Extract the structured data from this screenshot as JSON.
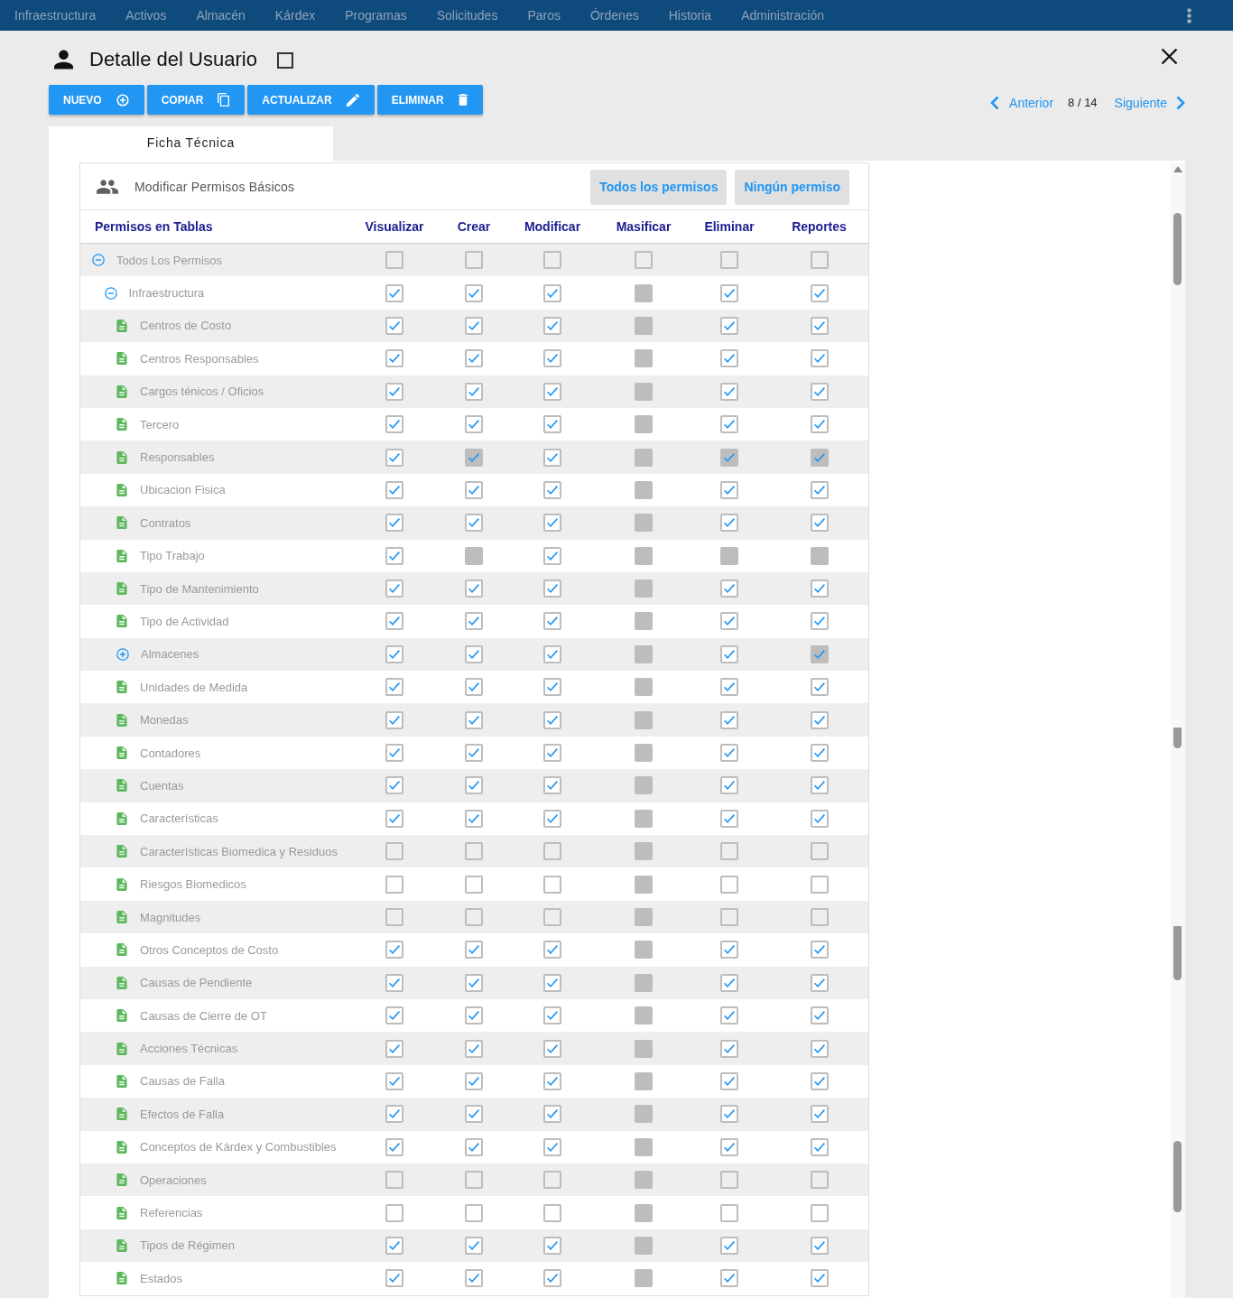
{
  "nav": {
    "items": [
      "Infraestructura",
      "Activos",
      "Almacén",
      "Kárdex",
      "Programas",
      "Solicitudes",
      "Paros",
      "Órdenes",
      "Historia",
      "Administración"
    ]
  },
  "header": {
    "title": "Detalle del Usuario",
    "checked": false
  },
  "toolbar": {
    "buttons": [
      {
        "label": "NUEVO",
        "kind": "new"
      },
      {
        "label": "COPIAR",
        "kind": "copy"
      },
      {
        "label": "ACTUALIZAR",
        "kind": "update"
      },
      {
        "label": "ELIMINAR",
        "kind": "delete"
      }
    ]
  },
  "pager": {
    "previous": "Anterior",
    "position": "8 / 14",
    "next": "Siguiente"
  },
  "tabs": [
    {
      "label": "Ficha Técnica",
      "selected": true
    }
  ],
  "permissions": {
    "title": "Modificar Permisos Básicos",
    "actions": [
      "Todos los permisos",
      "Ningún permiso"
    ],
    "columns": [
      "Permisos en Tablas",
      "Visualizar",
      "Crear",
      "Modificar",
      "Masificar",
      "Eliminar",
      "Reportes"
    ],
    "tree": [
      {
        "label": "Todos Los Permisos",
        "kind": "group",
        "expanded": true,
        "cells": [
          {
            "checked": false,
            "disabled": false
          },
          {
            "checked": false,
            "disabled": false
          },
          {
            "checked": false,
            "disabled": false
          },
          {
            "checked": false,
            "disabled": false
          },
          {
            "checked": false,
            "disabled": false
          },
          {
            "checked": false,
            "disabled": false
          }
        ],
        "children": [
          {
            "label": "Infraestructura",
            "kind": "group",
            "expanded": true,
            "cells": [
              {
                "checked": true,
                "disabled": false
              },
              {
                "checked": true,
                "disabled": false
              },
              {
                "checked": true,
                "disabled": false
              },
              {
                "checked": false,
                "disabled": true
              },
              {
                "checked": true,
                "disabled": false
              },
              {
                "checked": true,
                "disabled": false
              }
            ],
            "children": [
              {
                "label": "Centros de Costo",
                "kind": "table",
                "cells": [
                  {
                    "checked": true,
                    "disabled": false
                  },
                  {
                    "checked": true,
                    "disabled": false
                  },
                  {
                    "checked": true,
                    "disabled": false
                  },
                  {
                    "checked": false,
                    "disabled": true
                  },
                  {
                    "checked": true,
                    "disabled": false
                  },
                  {
                    "checked": true,
                    "disabled": false
                  }
                ]
              },
              {
                "label": "Centros Responsables",
                "kind": "table",
                "cells": [
                  {
                    "checked": true,
                    "disabled": false
                  },
                  {
                    "checked": true,
                    "disabled": false
                  },
                  {
                    "checked": true,
                    "disabled": false
                  },
                  {
                    "checked": false,
                    "disabled": true
                  },
                  {
                    "checked": true,
                    "disabled": false
                  },
                  {
                    "checked": true,
                    "disabled": false
                  }
                ]
              },
              {
                "label": "Cargos ténicos / Oficios",
                "kind": "table",
                "cells": [
                  {
                    "checked": true,
                    "disabled": false
                  },
                  {
                    "checked": true,
                    "disabled": false
                  },
                  {
                    "checked": true,
                    "disabled": false
                  },
                  {
                    "checked": false,
                    "disabled": true
                  },
                  {
                    "checked": true,
                    "disabled": false
                  },
                  {
                    "checked": true,
                    "disabled": false
                  }
                ]
              },
              {
                "label": "Tercero",
                "kind": "table",
                "cells": [
                  {
                    "checked": true,
                    "disabled": false
                  },
                  {
                    "checked": true,
                    "disabled": false
                  },
                  {
                    "checked": true,
                    "disabled": false
                  },
                  {
                    "checked": false,
                    "disabled": true
                  },
                  {
                    "checked": true,
                    "disabled": false
                  },
                  {
                    "checked": true,
                    "disabled": false
                  }
                ]
              },
              {
                "label": "Responsables",
                "kind": "table",
                "cells": [
                  {
                    "checked": true,
                    "disabled": false
                  },
                  {
                    "checked": true,
                    "disabled": true
                  },
                  {
                    "checked": true,
                    "disabled": false
                  },
                  {
                    "checked": false,
                    "disabled": true
                  },
                  {
                    "checked": true,
                    "disabled": true
                  },
                  {
                    "checked": true,
                    "disabled": true
                  }
                ]
              },
              {
                "label": "Ubicacion Fisica",
                "kind": "table",
                "cells": [
                  {
                    "checked": true,
                    "disabled": false
                  },
                  {
                    "checked": true,
                    "disabled": false
                  },
                  {
                    "checked": true,
                    "disabled": false
                  },
                  {
                    "checked": false,
                    "disabled": true
                  },
                  {
                    "checked": true,
                    "disabled": false
                  },
                  {
                    "checked": true,
                    "disabled": false
                  }
                ]
              },
              {
                "label": "Contratos",
                "kind": "table",
                "cells": [
                  {
                    "checked": true,
                    "disabled": false
                  },
                  {
                    "checked": true,
                    "disabled": false
                  },
                  {
                    "checked": true,
                    "disabled": false
                  },
                  {
                    "checked": false,
                    "disabled": true
                  },
                  {
                    "checked": true,
                    "disabled": false
                  },
                  {
                    "checked": true,
                    "disabled": false
                  }
                ]
              },
              {
                "label": "Tipo Trabajo",
                "kind": "table",
                "cells": [
                  {
                    "checked": true,
                    "disabled": false
                  },
                  {
                    "checked": false,
                    "disabled": true
                  },
                  {
                    "checked": true,
                    "disabled": false
                  },
                  {
                    "checked": false,
                    "disabled": true
                  },
                  {
                    "checked": false,
                    "disabled": true
                  },
                  {
                    "checked": false,
                    "disabled": true
                  }
                ]
              },
              {
                "label": "Tipo de Mantenimiento",
                "kind": "table",
                "cells": [
                  {
                    "checked": true,
                    "disabled": false
                  },
                  {
                    "checked": true,
                    "disabled": false
                  },
                  {
                    "checked": true,
                    "disabled": false
                  },
                  {
                    "checked": false,
                    "disabled": true
                  },
                  {
                    "checked": true,
                    "disabled": false
                  },
                  {
                    "checked": true,
                    "disabled": false
                  }
                ]
              },
              {
                "label": "Tipo de Actividad",
                "kind": "table",
                "cells": [
                  {
                    "checked": true,
                    "disabled": false
                  },
                  {
                    "checked": true,
                    "disabled": false
                  },
                  {
                    "checked": true,
                    "disabled": false
                  },
                  {
                    "checked": false,
                    "disabled": true
                  },
                  {
                    "checked": true,
                    "disabled": false
                  },
                  {
                    "checked": true,
                    "disabled": false
                  }
                ]
              },
              {
                "label": "Almacenes",
                "kind": "group",
                "expanded": false,
                "cells": [
                  {
                    "checked": true,
                    "disabled": false
                  },
                  {
                    "checked": true,
                    "disabled": false
                  },
                  {
                    "checked": true,
                    "disabled": false
                  },
                  {
                    "checked": false,
                    "disabled": true
                  },
                  {
                    "checked": true,
                    "disabled": false
                  },
                  {
                    "checked": true,
                    "disabled": true
                  }
                ]
              },
              {
                "label": "Unidades de Medida",
                "kind": "table",
                "cells": [
                  {
                    "checked": true,
                    "disabled": false
                  },
                  {
                    "checked": true,
                    "disabled": false
                  },
                  {
                    "checked": true,
                    "disabled": false
                  },
                  {
                    "checked": false,
                    "disabled": true
                  },
                  {
                    "checked": true,
                    "disabled": false
                  },
                  {
                    "checked": true,
                    "disabled": false
                  }
                ]
              },
              {
                "label": "Monedas",
                "kind": "table",
                "cells": [
                  {
                    "checked": true,
                    "disabled": false
                  },
                  {
                    "checked": true,
                    "disabled": false
                  },
                  {
                    "checked": true,
                    "disabled": false
                  },
                  {
                    "checked": false,
                    "disabled": true
                  },
                  {
                    "checked": true,
                    "disabled": false
                  },
                  {
                    "checked": true,
                    "disabled": false
                  }
                ]
              },
              {
                "label": "Contadores",
                "kind": "table",
                "cells": [
                  {
                    "checked": true,
                    "disabled": false
                  },
                  {
                    "checked": true,
                    "disabled": false
                  },
                  {
                    "checked": true,
                    "disabled": false
                  },
                  {
                    "checked": false,
                    "disabled": true
                  },
                  {
                    "checked": true,
                    "disabled": false
                  },
                  {
                    "checked": true,
                    "disabled": false
                  }
                ]
              },
              {
                "label": "Cuentas",
                "kind": "table",
                "cells": [
                  {
                    "checked": true,
                    "disabled": false
                  },
                  {
                    "checked": true,
                    "disabled": false
                  },
                  {
                    "checked": true,
                    "disabled": false
                  },
                  {
                    "checked": false,
                    "disabled": true
                  },
                  {
                    "checked": true,
                    "disabled": false
                  },
                  {
                    "checked": true,
                    "disabled": false
                  }
                ]
              },
              {
                "label": "Características",
                "kind": "table",
                "cells": [
                  {
                    "checked": true,
                    "disabled": false
                  },
                  {
                    "checked": true,
                    "disabled": false
                  },
                  {
                    "checked": true,
                    "disabled": false
                  },
                  {
                    "checked": false,
                    "disabled": true
                  },
                  {
                    "checked": true,
                    "disabled": false
                  },
                  {
                    "checked": true,
                    "disabled": false
                  }
                ]
              },
              {
                "label": "Características Biomedica y Residuos",
                "kind": "table",
                "cells": [
                  {
                    "checked": false,
                    "disabled": false
                  },
                  {
                    "checked": false,
                    "disabled": false
                  },
                  {
                    "checked": false,
                    "disabled": false
                  },
                  {
                    "checked": false,
                    "disabled": true
                  },
                  {
                    "checked": false,
                    "disabled": false
                  },
                  {
                    "checked": false,
                    "disabled": false
                  }
                ]
              },
              {
                "label": "Riesgos Biomedicos",
                "kind": "table",
                "cells": [
                  {
                    "checked": false,
                    "disabled": false
                  },
                  {
                    "checked": false,
                    "disabled": false
                  },
                  {
                    "checked": false,
                    "disabled": false
                  },
                  {
                    "checked": false,
                    "disabled": true
                  },
                  {
                    "checked": false,
                    "disabled": false
                  },
                  {
                    "checked": false,
                    "disabled": false
                  }
                ]
              },
              {
                "label": "Magnitudes",
                "kind": "table",
                "cells": [
                  {
                    "checked": false,
                    "disabled": false
                  },
                  {
                    "checked": false,
                    "disabled": false
                  },
                  {
                    "checked": false,
                    "disabled": false
                  },
                  {
                    "checked": false,
                    "disabled": true
                  },
                  {
                    "checked": false,
                    "disabled": false
                  },
                  {
                    "checked": false,
                    "disabled": false
                  }
                ]
              },
              {
                "label": "Otros Conceptos de Costo",
                "kind": "table",
                "cells": [
                  {
                    "checked": true,
                    "disabled": false
                  },
                  {
                    "checked": true,
                    "disabled": false
                  },
                  {
                    "checked": true,
                    "disabled": false
                  },
                  {
                    "checked": false,
                    "disabled": true
                  },
                  {
                    "checked": true,
                    "disabled": false
                  },
                  {
                    "checked": true,
                    "disabled": false
                  }
                ]
              },
              {
                "label": "Causas de Pendiente",
                "kind": "table",
                "cells": [
                  {
                    "checked": true,
                    "disabled": false
                  },
                  {
                    "checked": true,
                    "disabled": false
                  },
                  {
                    "checked": true,
                    "disabled": false
                  },
                  {
                    "checked": false,
                    "disabled": true
                  },
                  {
                    "checked": true,
                    "disabled": false
                  },
                  {
                    "checked": true,
                    "disabled": false
                  }
                ]
              },
              {
                "label": "Causas de Cierre de OT",
                "kind": "table",
                "cells": [
                  {
                    "checked": true,
                    "disabled": false
                  },
                  {
                    "checked": true,
                    "disabled": false
                  },
                  {
                    "checked": true,
                    "disabled": false
                  },
                  {
                    "checked": false,
                    "disabled": true
                  },
                  {
                    "checked": true,
                    "disabled": false
                  },
                  {
                    "checked": true,
                    "disabled": false
                  }
                ]
              },
              {
                "label": "Acciones Técnicas",
                "kind": "table",
                "cells": [
                  {
                    "checked": true,
                    "disabled": false
                  },
                  {
                    "checked": true,
                    "disabled": false
                  },
                  {
                    "checked": true,
                    "disabled": false
                  },
                  {
                    "checked": false,
                    "disabled": true
                  },
                  {
                    "checked": true,
                    "disabled": false
                  },
                  {
                    "checked": true,
                    "disabled": false
                  }
                ]
              },
              {
                "label": "Causas de Falla",
                "kind": "table",
                "cells": [
                  {
                    "checked": true,
                    "disabled": false
                  },
                  {
                    "checked": true,
                    "disabled": false
                  },
                  {
                    "checked": true,
                    "disabled": false
                  },
                  {
                    "checked": false,
                    "disabled": true
                  },
                  {
                    "checked": true,
                    "disabled": false
                  },
                  {
                    "checked": true,
                    "disabled": false
                  }
                ]
              },
              {
                "label": "Efectos de Falla",
                "kind": "table",
                "cells": [
                  {
                    "checked": true,
                    "disabled": false
                  },
                  {
                    "checked": true,
                    "disabled": false
                  },
                  {
                    "checked": true,
                    "disabled": false
                  },
                  {
                    "checked": false,
                    "disabled": true
                  },
                  {
                    "checked": true,
                    "disabled": false
                  },
                  {
                    "checked": true,
                    "disabled": false
                  }
                ]
              },
              {
                "label": "Conceptos de Kárdex y Combustibles",
                "kind": "table",
                "cells": [
                  {
                    "checked": true,
                    "disabled": false
                  },
                  {
                    "checked": true,
                    "disabled": false
                  },
                  {
                    "checked": true,
                    "disabled": false
                  },
                  {
                    "checked": false,
                    "disabled": true
                  },
                  {
                    "checked": true,
                    "disabled": false
                  },
                  {
                    "checked": true,
                    "disabled": false
                  }
                ]
              },
              {
                "label": "Operaciones",
                "kind": "table",
                "cells": [
                  {
                    "checked": false,
                    "disabled": false
                  },
                  {
                    "checked": false,
                    "disabled": false
                  },
                  {
                    "checked": false,
                    "disabled": false
                  },
                  {
                    "checked": false,
                    "disabled": true
                  },
                  {
                    "checked": false,
                    "disabled": false
                  },
                  {
                    "checked": false,
                    "disabled": false
                  }
                ]
              },
              {
                "label": "Referencias",
                "kind": "table",
                "cells": [
                  {
                    "checked": false,
                    "disabled": false
                  },
                  {
                    "checked": false,
                    "disabled": false
                  },
                  {
                    "checked": false,
                    "disabled": false
                  },
                  {
                    "checked": false,
                    "disabled": true
                  },
                  {
                    "checked": false,
                    "disabled": false
                  },
                  {
                    "checked": false,
                    "disabled": false
                  }
                ]
              },
              {
                "label": "Tipos de Régimen",
                "kind": "table",
                "cells": [
                  {
                    "checked": true,
                    "disabled": false
                  },
                  {
                    "checked": true,
                    "disabled": false
                  },
                  {
                    "checked": true,
                    "disabled": false
                  },
                  {
                    "checked": false,
                    "disabled": true
                  },
                  {
                    "checked": true,
                    "disabled": false
                  },
                  {
                    "checked": true,
                    "disabled": false
                  }
                ]
              },
              {
                "label": "Estados",
                "kind": "table",
                "cells": [
                  {
                    "checked": true,
                    "disabled": false
                  },
                  {
                    "checked": true,
                    "disabled": false
                  },
                  {
                    "checked": true,
                    "disabled": false
                  },
                  {
                    "checked": false,
                    "disabled": true
                  },
                  {
                    "checked": true,
                    "disabled": false
                  },
                  {
                    "checked": true,
                    "disabled": false
                  }
                ]
              }
            ]
          }
        ]
      }
    ]
  }
}
